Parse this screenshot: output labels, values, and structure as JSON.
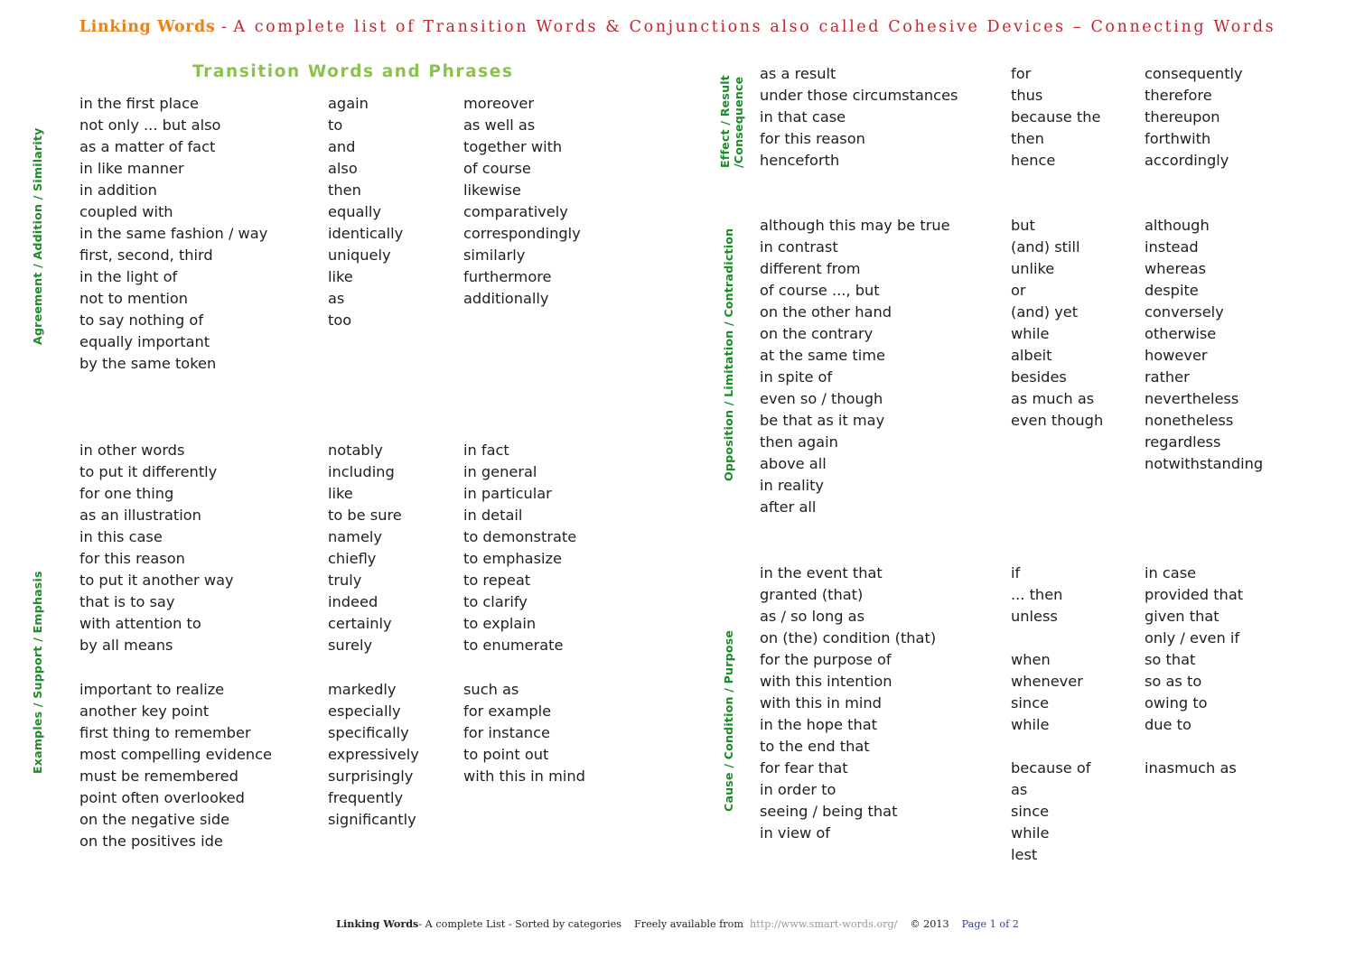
{
  "header": {
    "brand": "Linking Words",
    "dash": " - ",
    "subtitle": "A complete list of Transition Words & Conjunctions also called Cohesive Devices – Connecting Words"
  },
  "section_title": "Transition Words and Phrases",
  "colors": {
    "brand_orange": "#E8821A",
    "title_red": "#C0272D",
    "section_green": "#8CC152",
    "label_green": "#1E8B2B",
    "link_gray": "#9a9a9a",
    "page_blue": "#2b3e9e"
  },
  "groups": [
    {
      "id": "agreement",
      "label": "Agreement / Addition / Similarity",
      "columns": [
        [
          "in the first place",
          "not only ... but also",
          "as a matter of fact",
          "in like manner",
          "in addition",
          "coupled with",
          "in the same fashion / way",
          "first, second, third",
          "in the light of",
          "not to mention",
          "to say nothing of",
          "equally important",
          "by the same token"
        ],
        [
          "again",
          "to",
          "and",
          "also",
          "then",
          "equally",
          "identically",
          "uniquely",
          "like",
          "as",
          "too"
        ],
        [
          "moreover",
          "as well as",
          "together with",
          "of course",
          "likewise",
          "comparatively",
          "correspondingly",
          "similarly",
          "furthermore",
          "additionally"
        ]
      ]
    },
    {
      "id": "examples-a",
      "label": "Examples / Support / Emphasis",
      "columns": [
        [
          "in other words",
          "to put it differently",
          "for one thing",
          "as an illustration",
          "in this case",
          "for this reason",
          "to put it another way",
          "that is to say",
          "with attention to",
          "by all means"
        ],
        [
          "notably",
          "including",
          "like",
          "to be sure",
          "namely",
          "chiefly",
          "truly",
          "indeed",
          "certainly",
          "surely"
        ],
        [
          "in fact",
          "in general",
          "in particular",
          "in detail",
          "to demonstrate",
          "to emphasize",
          "to repeat",
          "to clarify",
          "to explain",
          "to enumerate"
        ]
      ]
    },
    {
      "id": "examples-b",
      "label": "",
      "columns": [
        [
          "important to realize",
          "another key point",
          "first thing to remember",
          "most compelling evidence",
          "must be remembered",
          "point often overlooked",
          "on the negative side",
          "on the positives ide"
        ],
        [
          "markedly",
          "especially",
          "specifically",
          "expressively",
          "surprisingly",
          "frequently",
          "significantly"
        ],
        [
          "such as",
          "for example",
          "for instance",
          "to point out",
          "with this in mind"
        ]
      ]
    },
    {
      "id": "effect",
      "label": "Effect / Result / Consequence",
      "label_line1": "Effect / Result /",
      "label_line2": "Consequence",
      "columns": [
        [
          "as a result",
          "under those circumstances",
          "in that case",
          "for this reason",
          "henceforth"
        ],
        [
          "for",
          "thus",
          "because the",
          "then",
          "hence"
        ],
        [
          "consequently",
          "therefore",
          "thereupon",
          "forthwith",
          "accordingly"
        ]
      ]
    },
    {
      "id": "opposition",
      "label": "Opposition / Limitation / Contradiction",
      "columns": [
        [
          "although this may be true",
          "in contrast",
          "different from",
          "of course ..., but",
          "on the other hand",
          "on the contrary",
          "at the same time",
          "in spite of",
          "even so / though",
          "be that as it may",
          "then again",
          "above all",
          "in reality",
          "after all"
        ],
        [
          "but",
          "(and) still",
          "unlike",
          "or",
          "(and) yet",
          "while",
          "albeit",
          "besides",
          "as much as",
          "even though"
        ],
        [
          "although",
          "instead",
          "whereas",
          "despite",
          "conversely",
          "otherwise",
          "however",
          "rather",
          "nevertheless",
          "nonetheless",
          "regardless",
          "notwithstanding"
        ]
      ]
    },
    {
      "id": "cause-a",
      "label": "Cause / Condition / Purpose",
      "columns": [
        [
          "in the event that",
          "granted (that)",
          "as / so long as",
          "on (the) condition (that)",
          "for the purpose of",
          "with this intention",
          "with this in mind",
          "in the hope that",
          "to the end that"
        ],
        [
          "if",
          "... then",
          "unless",
          "",
          "when",
          "whenever",
          "since",
          "while"
        ],
        [
          "in case",
          "provided that",
          "given that",
          "only / even if",
          "so that",
          "so as to",
          "owing to",
          "due to"
        ]
      ]
    },
    {
      "id": "cause-b",
      "label": "",
      "columns": [
        [
          "for fear that",
          "in order to",
          "seeing / being that",
          "in view of"
        ],
        [
          "because of",
          "as",
          "since",
          "while",
          "lest"
        ],
        [
          "inasmuch as"
        ]
      ]
    }
  ],
  "footer": {
    "brand": "Linking Words",
    "desc": "- A complete List - Sorted by categories",
    "available": "Freely available from",
    "url": "http://www.smart-words.org/",
    "copyright": "© 2013",
    "page": "Page 1 of 2"
  }
}
